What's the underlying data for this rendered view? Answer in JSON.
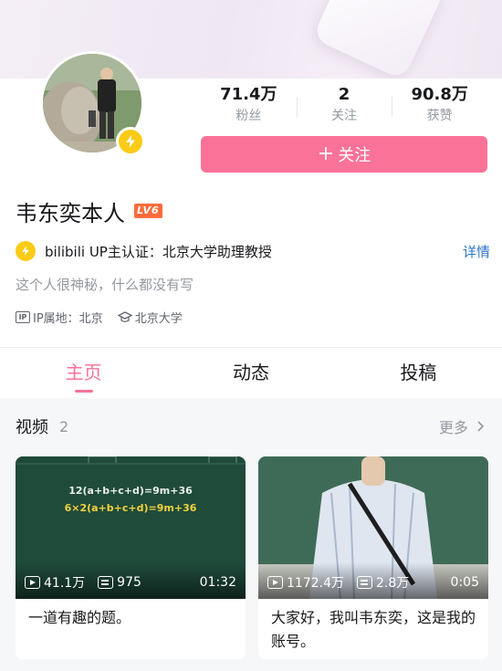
{
  "profile": {
    "name": "韦东奕本人",
    "level": "LV6",
    "stats": [
      {
        "value": "71.4万",
        "label": "粉丝"
      },
      {
        "value": "2",
        "label": "关注"
      },
      {
        "value": "90.8万",
        "label": "获赞"
      }
    ],
    "follow_label": "关注",
    "certification": "bilibili UP主认证：北京大学助理教授",
    "cert_detail": "详情",
    "signature": "这个人很神秘，什么都没有写",
    "ip_location": "IP属地：北京",
    "school": "北京大学"
  },
  "tabs": [
    "主页",
    "动态",
    "投稿"
  ],
  "videos_section": {
    "title": "视频",
    "count": "2",
    "more": "更多"
  },
  "videos": [
    {
      "plays": "41.1万",
      "danmaku": "975",
      "duration": "01:32",
      "title": "一道有趣的题。",
      "board_line1": "12(a+b+c+d)=9m+36",
      "board_line2": "6×2(a+b+c+d)=9m+36"
    },
    {
      "plays": "1172.4万",
      "danmaku": "2.8万",
      "duration": "0:05",
      "title": "大家好，我叫韦东奕，这是我的账号。"
    }
  ],
  "colors": {
    "accent": "#fb7299",
    "badge": "#fbcb16",
    "link": "#2a76c6"
  }
}
